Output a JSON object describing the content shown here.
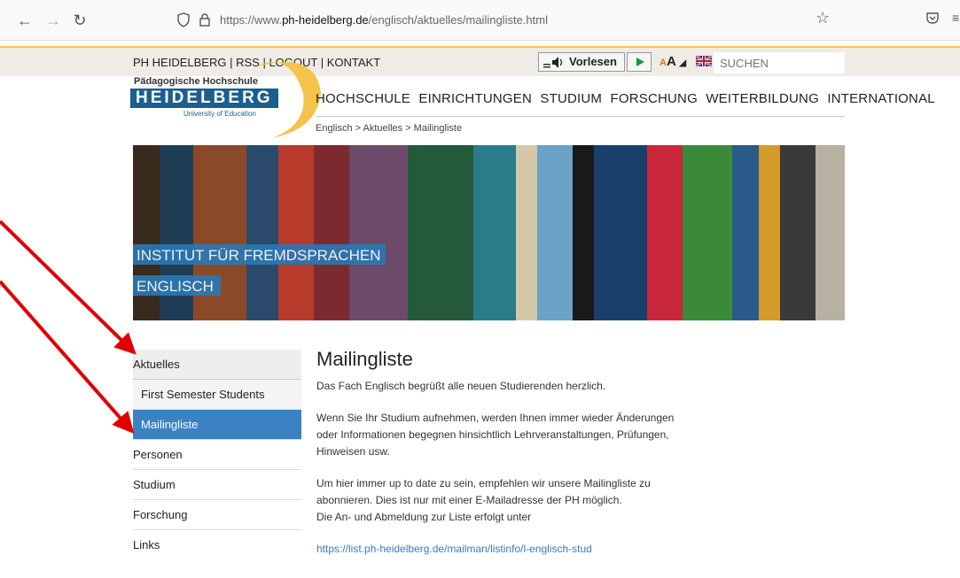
{
  "browser": {
    "url_prefix": "https://www.",
    "url_domain": "ph-heidelberg.de",
    "url_path": "/englisch/aktuelles/mailingliste.html"
  },
  "util": {
    "links": [
      "PH HEIDELBERG",
      "RSS",
      "LOGOUT",
      "KONTAKT"
    ],
    "vorlesen": "Vorlesen",
    "font_size": "AA",
    "search_placeholder": "SUCHEN"
  },
  "logo": {
    "top": "Pädagogische Hochschule",
    "main": "HEIDELBERG",
    "sub": "University of Education"
  },
  "main_nav": [
    "HOCHSCHULE",
    "EINRICHTUNGEN",
    "STUDIUM",
    "FORSCHUNG",
    "WEITERBILDUNG",
    "INTERNATIONAL"
  ],
  "breadcrumb": "Englisch > Aktuelles > Mailingliste",
  "banner": {
    "title": "INSTITUT FÜR FREMDSPRACHEN",
    "subtitle": "ENGLISCH"
  },
  "sidebar": {
    "items": [
      {
        "label": "Aktuelles"
      },
      {
        "label": "First Semester Students"
      },
      {
        "label": "Mailingliste"
      },
      {
        "label": "Personen"
      },
      {
        "label": "Studium"
      },
      {
        "label": "Forschung"
      },
      {
        "label": "Links"
      }
    ]
  },
  "content": {
    "title": "Mailingliste",
    "p1": "Das Fach Englisch begrüßt alle neuen Studierenden herzlich.",
    "p2": "Wenn Sie Ihr Studium aufnehmen, werden Ihnen immer wieder Änderungen oder Informationen begegnen hinsichtlich Lehrveranstaltungen, Prüfungen, Hinweisen usw.",
    "p3a": "Um hier immer up to date zu sein, empfehlen wir unsere Mailingliste zu abonnieren. Dies ist nur mit einer E-Mailadresse der PH möglich.",
    "p3b": "Die An- und Abmeldung zur Liste erfolgt unter",
    "link": "https://list.ph-heidelberg.de/mailman/listinfo/l-englisch-stud"
  },
  "colors": {
    "accent_blue": "#3b82c4",
    "logo_blue": "#1b5f8f",
    "logo_yellow": "#f4c34a",
    "arrow_red": "#e00000"
  }
}
